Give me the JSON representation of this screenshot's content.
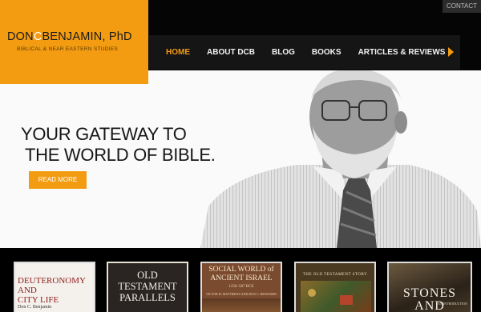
{
  "header": {
    "contact_label": "CONTACT",
    "logo": {
      "part1": "DON",
      "part2": "C",
      "part3": "BENJAMIN, PhD",
      "subtitle": "BIBLICAL & NEAR EASTERN STUDIES"
    }
  },
  "nav": {
    "items": [
      {
        "label": "HOME",
        "active": true
      },
      {
        "label": "ABOUT DCB",
        "active": false
      },
      {
        "label": "BLOG",
        "active": false
      },
      {
        "label": "BOOKS",
        "active": false
      },
      {
        "label": "ARTICLES & REVIEWS",
        "active": false
      }
    ]
  },
  "hero": {
    "line1": "YOUR GATEWAY TO",
    "line2": "THE WORLD OF BIBLE.",
    "button": "READ MORE"
  },
  "books": [
    {
      "title_lines": [
        "DEUTERONOMY",
        "AND",
        "CITY LIFE"
      ],
      "author": "Don C. Benjamin"
    },
    {
      "title_lines": [
        "OLD",
        "TESTAMENT",
        "PARALLELS"
      ]
    },
    {
      "title_lines": [
        "SOCIAL WORLD of",
        "ANCIENT ISRAEL"
      ],
      "subtitle": "1250–587 BCE",
      "author": "VICTOR H. MATTHEWS AND DON C. BENJAMIN"
    },
    {
      "title_lines": [
        "THE OLD TESTAMENT STORY"
      ]
    },
    {
      "title_lines": [
        "STONES",
        "AND"
      ],
      "subtitle": "AN INTRODUCTION"
    }
  ],
  "colors": {
    "accent": "#f39c12",
    "nav_bg": "#151515",
    "page_bg": "#000000"
  }
}
